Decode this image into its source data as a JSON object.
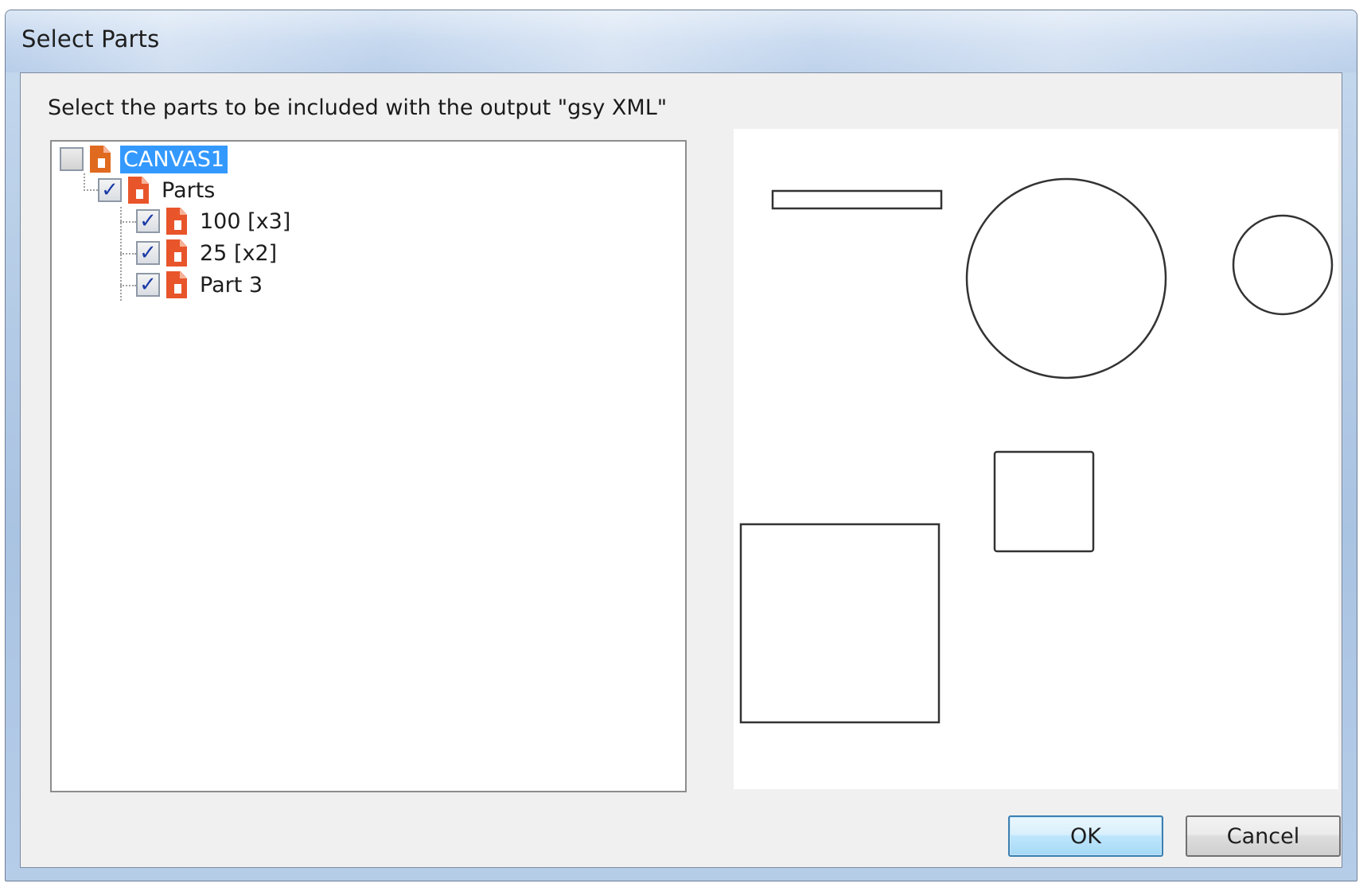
{
  "window": {
    "title": "Select Parts"
  },
  "instruction": "Select the parts to be included with the output \"gsy XML\"",
  "tree": {
    "root": {
      "label": "CANVAS1",
      "checked": false,
      "selected": true,
      "icon": "canvas-doc-icon"
    },
    "group": {
      "label": "Parts",
      "checked": true,
      "icon": "parts-doc-icon"
    },
    "items": [
      {
        "label": "100 [x3]",
        "checked": true,
        "icon": "part-doc-icon"
      },
      {
        "label": "25 [x2]",
        "checked": true,
        "icon": "part-doc-icon"
      },
      {
        "label": "Part 3",
        "checked": true,
        "icon": "part-doc-icon"
      }
    ],
    "check_mark": "✓"
  },
  "preview": {
    "shapes": [
      "thin-rectangle",
      "large-circle",
      "small-circle",
      "small-square",
      "large-square"
    ]
  },
  "buttons": {
    "ok_label": "OK",
    "cancel_label": "Cancel"
  },
  "colors": {
    "selection": "#3399ff",
    "part_icon": "#e8552a",
    "ok_border": "#3c7fb1"
  }
}
